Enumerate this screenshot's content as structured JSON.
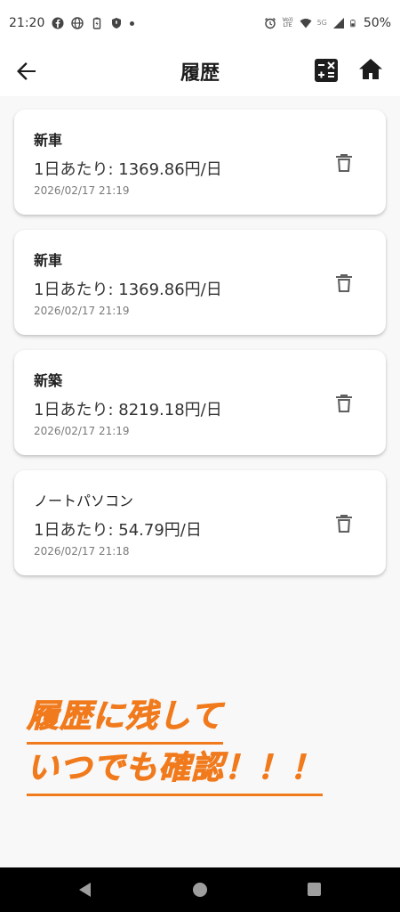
{
  "status_bar": {
    "time": "21:20",
    "battery": "50%",
    "volte": "Vo))\nLTE",
    "network": "5G"
  },
  "header": {
    "title": "履歴"
  },
  "history": [
    {
      "name": "新車",
      "daily_cost": "1日あたり: 1369.86円/日",
      "date": "2026/02/17 21:19"
    },
    {
      "name": "新車",
      "daily_cost": "1日あたり: 1369.86円/日",
      "date": "2026/02/17 21:19"
    },
    {
      "name": "新築",
      "daily_cost": "1日あたり: 8219.18円/日",
      "date": "2026/02/17 21:19"
    },
    {
      "name": "ノートパソコン",
      "daily_cost": "1日あたり: 54.79円/日",
      "date": "2026/02/17 21:18"
    }
  ],
  "promo": {
    "line1": "履歴に残して",
    "line2": "いつでも確認！！！"
  },
  "colors": {
    "accent": "#f07a1c",
    "background": "#f8f8f8",
    "card": "#ffffff"
  }
}
